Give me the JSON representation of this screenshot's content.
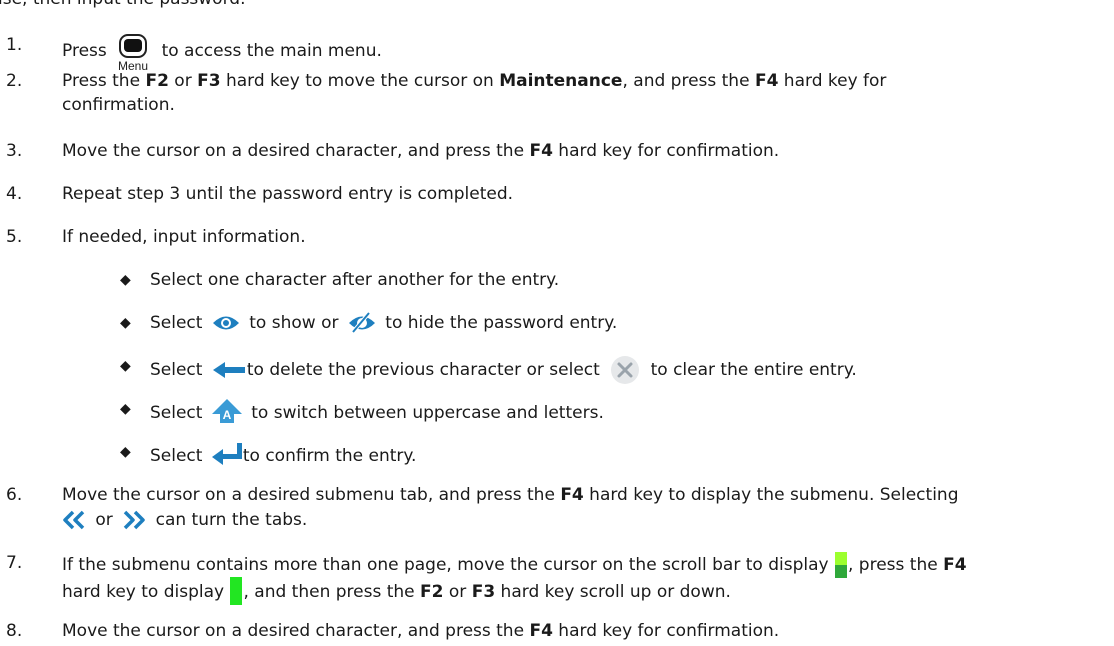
{
  "steps": {
    "s0_tail": "ise, then input the password.",
    "s1_num": "1.",
    "s1_a": "Press",
    "s1_icon_label": "Menu",
    "s1_b": "to access the main menu.",
    "s2_num": "2.",
    "s2_a": "Press the ",
    "s2_f2": "F2",
    "s2_or": " or ",
    "s2_f3": "F3",
    "s2_b": " hard key to move the cursor on ",
    "s2_maint": "Maintenance",
    "s2_c": ", and press the ",
    "s2_f4": "F4",
    "s2_d": " hard key for",
    "s2_line2": "confirmation.",
    "s3_num": "3.",
    "s3_a": "Move the cursor on a desired character, and press the ",
    "s3_f4": "F4",
    "s3_b": " hard key for confirmation.",
    "s4_num": "4.",
    "s4_text": "Repeat step 3 until the password entry is completed.",
    "s5_num": "5.",
    "s5_text": "If needed, input information.",
    "b1": "Select one character after another for the entry.",
    "b2_a": "Select",
    "b2_b": "to show or",
    "b2_c": "to hide the password entry.",
    "b3_a": "Select",
    "b3_b": "to delete the previous character or select",
    "b3_c": "to clear the entire entry.",
    "b4_a": "Select",
    "b4_icon_letter": "A",
    "b4_b": "to switch between uppercase and letters.",
    "b5_a": "Select",
    "b5_b": "to confirm the entry.",
    "s6_num": "6.",
    "s6_a": "Move the cursor on a desired submenu tab, and press the ",
    "s6_f4": "F4",
    "s6_b": " hard key to display the submenu. Selecting",
    "s6_or": "or",
    "s6_c": "can turn the tabs.",
    "s7_num": "7.",
    "s7_a": "If the submenu contains more than one page, move the cursor on the scroll bar to display",
    "s7_b": ", press the ",
    "s7_f4a": "F4",
    "s7_c": "hard key to display",
    "s7_d": ", and then press the ",
    "s7_f2": "F2",
    "s7_or": " or ",
    "s7_f3": "F3",
    "s7_e": " hard key scroll up or down.",
    "s8_num": "8.",
    "s8_a": "Move the cursor on a desired character, and press the ",
    "s8_f4": "F4",
    "s8_b": " hard key for confirmation."
  },
  "icons": {
    "menu": "menu-key-icon",
    "eye": "eye-show-icon",
    "eye_off": "eye-hide-icon",
    "backspace": "backspace-arrow-icon",
    "clear": "clear-x-icon",
    "shift": "shift-uppercase-icon",
    "enter": "enter-arrow-icon",
    "prev": "double-chevron-left-icon",
    "next": "double-chevron-right-icon",
    "scroll_dual": "scrollbar-dual-icon",
    "scroll_active": "scrollbar-active-icon"
  },
  "colors": {
    "text": "#1a1a1a",
    "icon_blue": "#1e7fbf",
    "icon_grey": "#9aa3ab",
    "scroll_green": "#22e622",
    "scroll_lime": "#9cff2e"
  }
}
